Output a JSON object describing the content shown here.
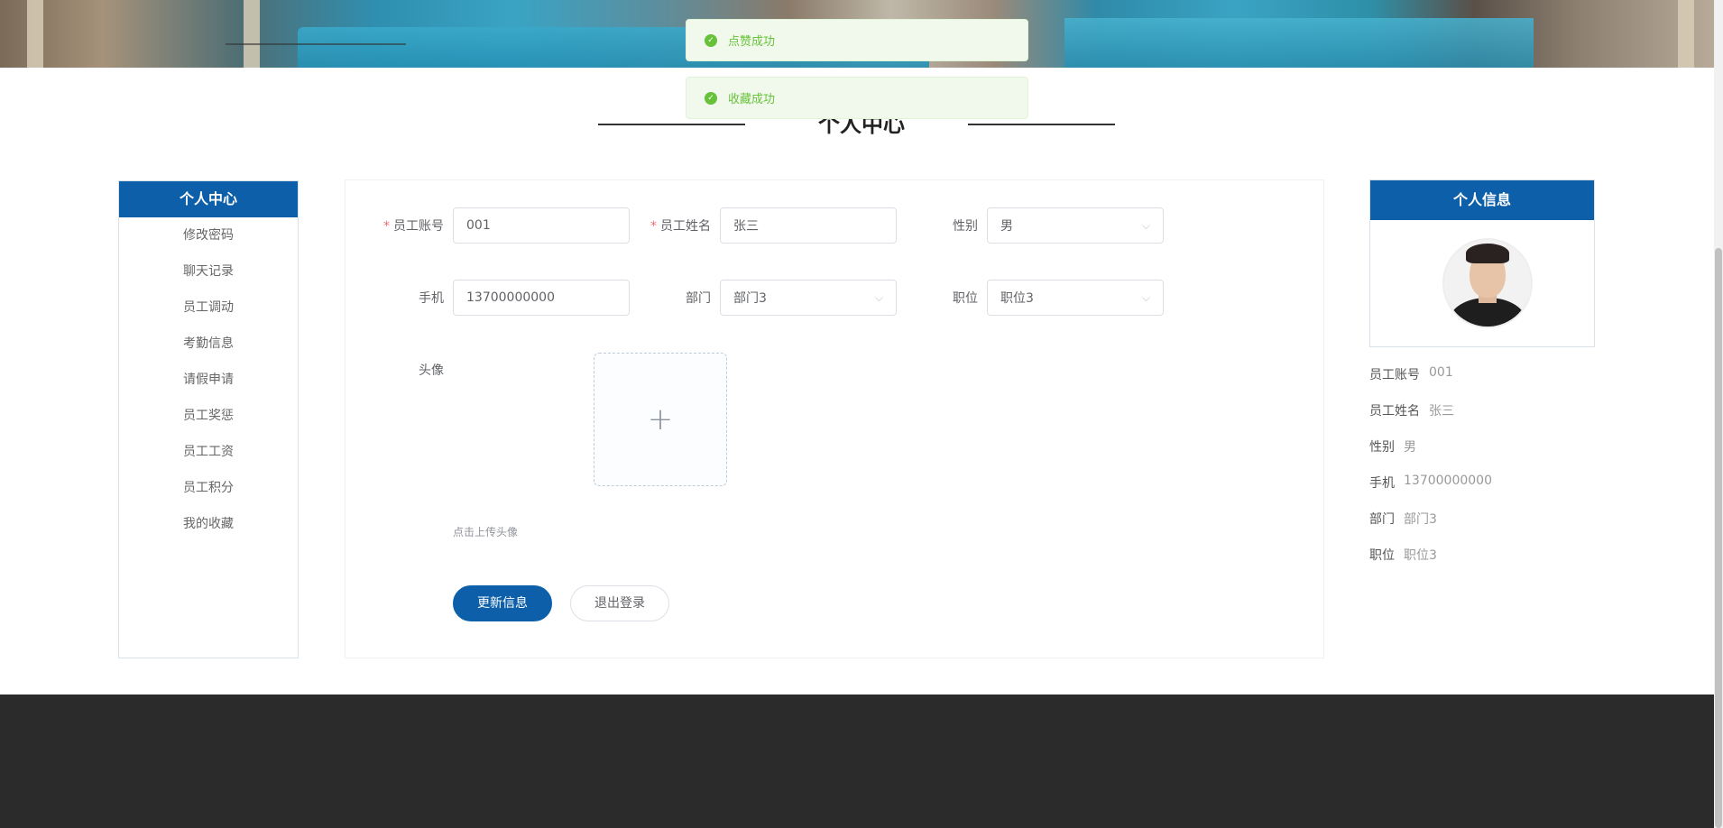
{
  "toasts": [
    {
      "message": "点赞成功"
    },
    {
      "message": "收藏成功"
    }
  ],
  "section_title": "个人中心",
  "left_menu": {
    "title": "个人中心",
    "items": [
      "修改密码",
      "聊天记录",
      "员工调动",
      "考勤信息",
      "请假申请",
      "员工奖惩",
      "员工工资",
      "员工积分",
      "我的收藏"
    ]
  },
  "form": {
    "account_label": "员工账号",
    "account_value": "001",
    "name_label": "员工姓名",
    "name_value": "张三",
    "gender_label": "性别",
    "gender_value": "男",
    "phone_label": "手机",
    "phone_value": "13700000000",
    "dept_label": "部门",
    "dept_value": "部门3",
    "position_label": "职位",
    "position_value": "职位3",
    "avatar_label": "头像",
    "upload_hint": "点击上传头像",
    "update_button": "更新信息",
    "logout_button": "退出登录"
  },
  "info_panel": {
    "title": "个人信息",
    "rows": [
      {
        "key": "员工账号",
        "value": "001"
      },
      {
        "key": "员工姓名",
        "value": "张三"
      },
      {
        "key": "性别",
        "value": "男"
      },
      {
        "key": "手机",
        "value": "13700000000"
      },
      {
        "key": "部门",
        "value": "部门3"
      },
      {
        "key": "职位",
        "value": "职位3"
      }
    ]
  },
  "colors": {
    "primary": "#0c5fa8",
    "success": "#67c23a",
    "footer": "#2b2b2b"
  },
  "icons": {
    "toast": "check-circle-icon",
    "select": "chevron-down-icon",
    "upload": "plus-icon"
  }
}
